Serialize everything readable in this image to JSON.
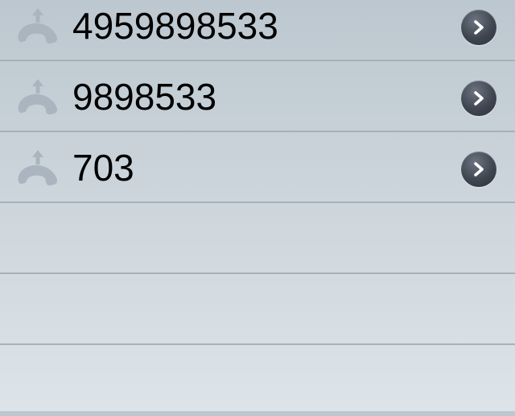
{
  "recents": [
    {
      "number": "4959898533",
      "icon": "outgoing-call-icon",
      "detail_icon": "chevron-right-icon"
    },
    {
      "number": "9898533",
      "icon": "outgoing-call-icon",
      "detail_icon": "chevron-right-icon"
    },
    {
      "number": "703",
      "icon": "outgoing-call-icon",
      "detail_icon": "chevron-right-icon"
    }
  ],
  "colors": {
    "background_top": "#bcc7cf",
    "background_bottom": "#dde4e9",
    "separator": "#a7b1b9",
    "icon": "#aab5bf",
    "detail_button": "#3f4650"
  }
}
